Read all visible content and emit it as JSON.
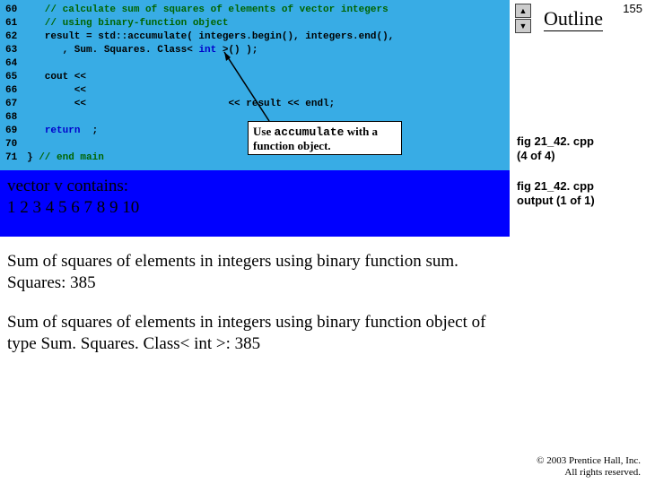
{
  "slide_number": "155",
  "outline_label": "Outline",
  "line_numbers": [
    "60",
    "61",
    "62",
    "63",
    "64",
    "65",
    "66",
    "67",
    "68",
    "69",
    "70",
    "71"
  ],
  "code": {
    "l60": "   // calculate sum of squares of elements of vector integers",
    "l61": "   // using binary-function object",
    "l62a": "   result = std::accumulate( integers.begin(), integers.end(),",
    "l63a": "      , Sum. Squares. Class< ",
    "l63b": "int",
    "l63c": " >() );",
    "l65": "   cout <<",
    "l66": "        <<",
    "l67a": "        <<",
    "l67b": "                        << result << endl;",
    "l69a": "   ",
    "l69b": "return",
    "l69c": "  ;",
    "l71a": "} ",
    "l71b": "// end main"
  },
  "callout": {
    "text1": "Use ",
    "kw": "accumulate",
    "text2": " with a function object."
  },
  "output_block": {
    "line1": "vector v contains:",
    "line2": "1 2 3 4 5 6 7 8 9 10"
  },
  "output2_text": "Sum of squares of elements in integers using binary function sum. Squares: 385",
  "output3_text": "Sum of squares of elements in integers using binary function object of type Sum. Squares. Class< int >: 385",
  "figref1": {
    "a": "fig 21_42. cpp",
    "b": "(4 of 4)"
  },
  "figref2": {
    "a": "fig 21_42. cpp",
    "b": "output (1 of 1)"
  },
  "copyright": {
    "a": "© 2003 Prentice Hall, Inc.",
    "b": "All rights reserved."
  }
}
